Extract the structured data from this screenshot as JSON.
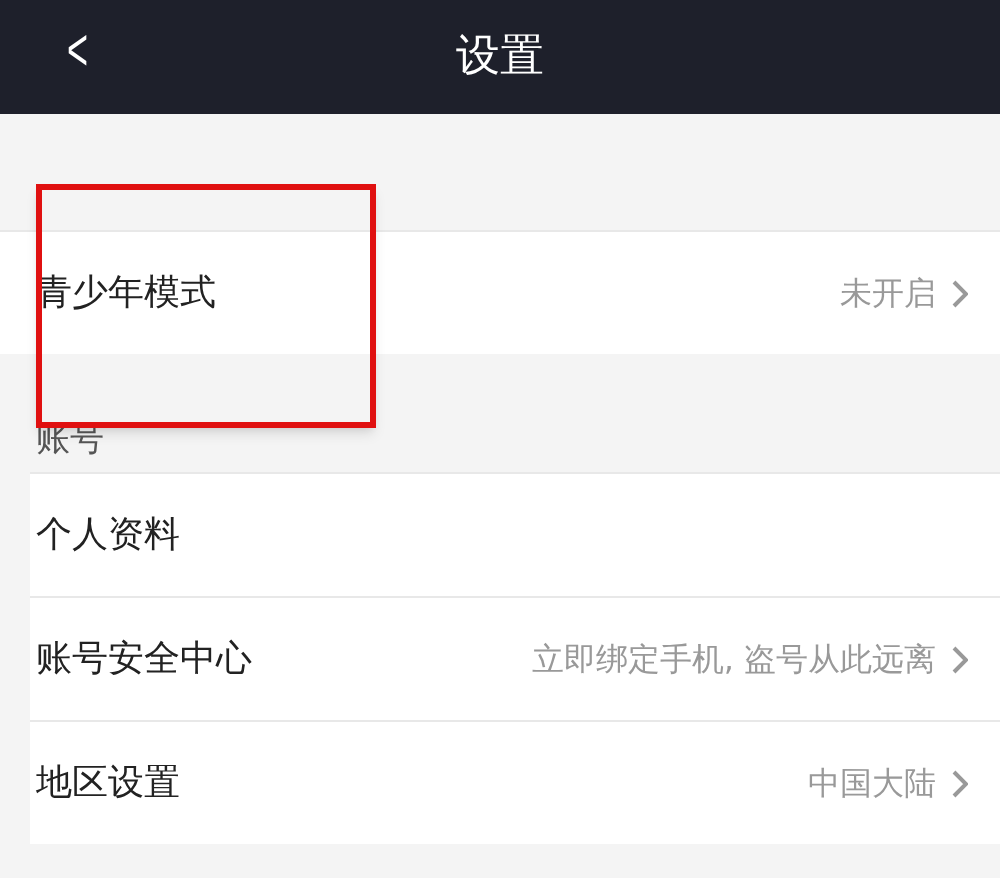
{
  "header": {
    "back": "<",
    "title": "设置"
  },
  "sections": [
    {
      "rows": [
        {
          "title": "青少年模式",
          "value": "未开启",
          "chevron": true
        }
      ]
    },
    {
      "label": "账号",
      "rows": [
        {
          "title": "个人资料",
          "chevron": false
        },
        {
          "title": "账号安全中心",
          "value": "立即绑定手机, 盗号从此远离",
          "chevron": true
        },
        {
          "title": "地区设置",
          "value": "中国大陆",
          "chevron": true
        }
      ]
    }
  ],
  "annotation": {
    "kind": "highlight"
  }
}
